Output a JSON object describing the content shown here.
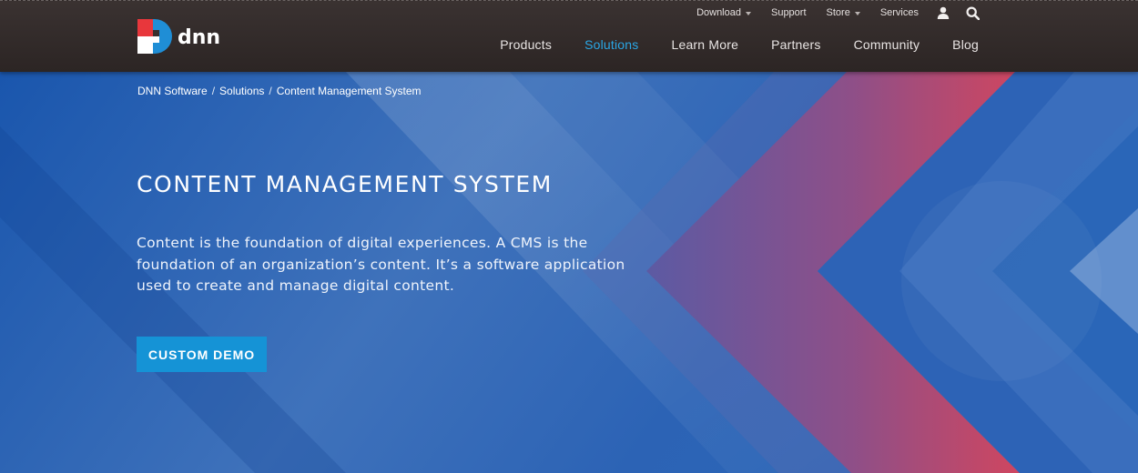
{
  "brand": {
    "wordmark": "dnn",
    "colors": {
      "red": "#e8373c",
      "blue": "#1f8ed6",
      "dark": "#2d2625",
      "white": "#ffffff"
    }
  },
  "utility_nav": {
    "items": [
      {
        "label": "Download",
        "has_dropdown": true
      },
      {
        "label": "Support",
        "has_dropdown": false
      },
      {
        "label": "Store",
        "has_dropdown": true
      },
      {
        "label": "Services",
        "has_dropdown": false
      }
    ],
    "icons": [
      "user-icon",
      "search-icon"
    ]
  },
  "main_nav": {
    "items": [
      {
        "label": "Products",
        "active": false
      },
      {
        "label": "Solutions",
        "active": true
      },
      {
        "label": "Learn More",
        "active": false
      },
      {
        "label": "Partners",
        "active": false
      },
      {
        "label": "Community",
        "active": false
      },
      {
        "label": "Blog",
        "active": false
      }
    ],
    "active_color": "#2aa7e6"
  },
  "breadcrumb": {
    "items": [
      "DNN Software",
      "Solutions",
      "Content Management System"
    ],
    "separator": "/"
  },
  "hero": {
    "title": "CONTENT MANAGEMENT SYSTEM",
    "description": "Content is the foundation of digital experiences. A CMS is the foundation of an organization’s content. It’s a software application used to create and manage digital content.",
    "cta_label": "CUSTOM DEMO",
    "cta_color": "#1593d6",
    "background_colors": [
      "#1a56ad",
      "#4f83c2",
      "#7d4f8e",
      "#c9475f"
    ]
  }
}
